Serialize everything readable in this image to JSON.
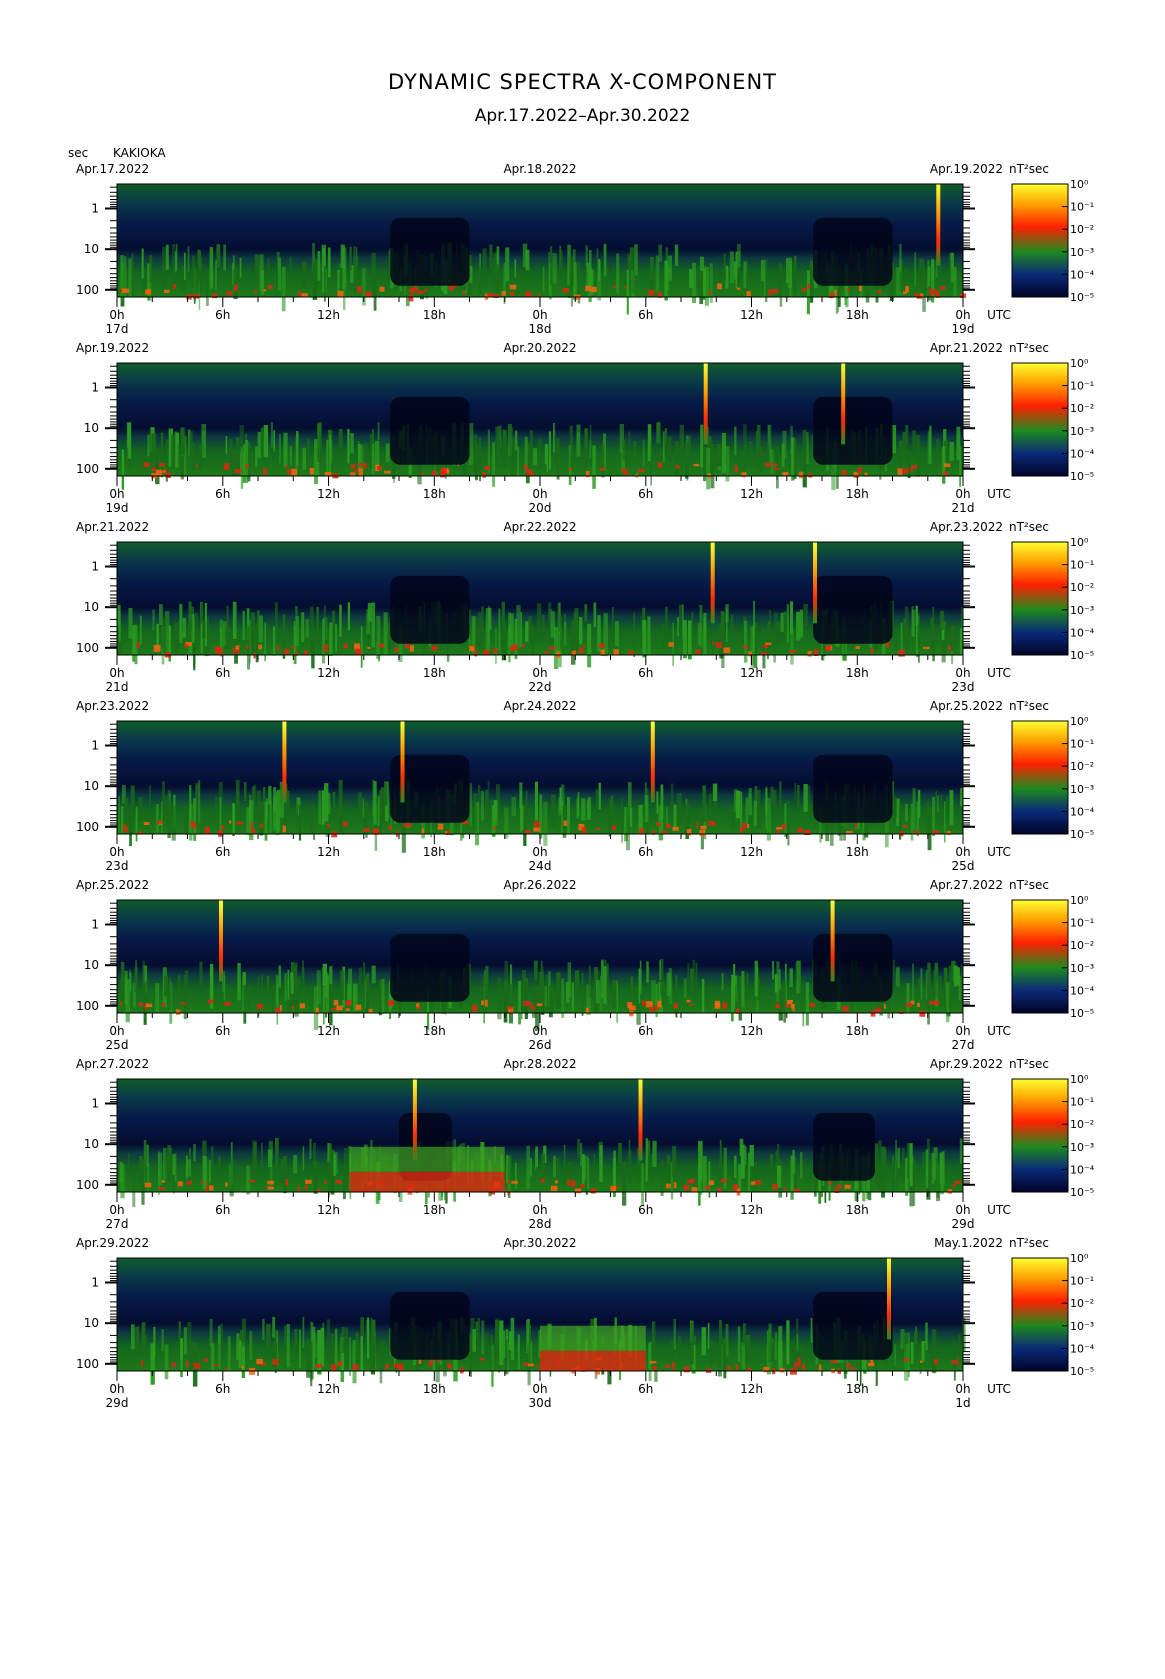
{
  "title": "DYNAMIC SPECTRA X-COMPONENT",
  "subtitle": "Apr.17.2022–Apr.30.2022",
  "y_unit": "sec",
  "station": "KAKIOKA",
  "colorbar_unit": "nT²sec",
  "time_unit": "UTC",
  "chart_data": {
    "type": "heatmap",
    "title": "DYNAMIC SPECTRA X-COMPONENT",
    "subtitle": "Apr.17.2022–Apr.30.2022",
    "ylabel": "sec",
    "yscale": "log",
    "ylim_period_sec": [
      0.25,
      150
    ],
    "yticks": [
      "1",
      "10",
      "100"
    ],
    "xticks": [
      "0h",
      "6h",
      "12h",
      "18h",
      "0h",
      "6h",
      "12h",
      "18h",
      "0h"
    ],
    "colorbar": {
      "unit": "nT²sec",
      "ticks": [
        "10⁰",
        "10⁻¹",
        "10⁻²",
        "10⁻³",
        "10⁻⁴",
        "10⁻⁵"
      ],
      "colors": [
        "#000428",
        "#0a2a78",
        "#1e8a1e",
        "#ff2000",
        "#ffa000",
        "#ffff30"
      ]
    },
    "panels": [
      {
        "dates": [
          "Apr.17.2022",
          "Apr.18.2022",
          "Apr.19.2022"
        ],
        "days": [
          "17d",
          "18d",
          "19d"
        ],
        "bursts_hours": [
          46.6
        ],
        "quiet_hours": [
          [
            15.5,
            20
          ],
          [
            39.5,
            44
          ]
        ],
        "strong_hours": []
      },
      {
        "dates": [
          "Apr.19.2022",
          "Apr.20.2022",
          "Apr.21.2022"
        ],
        "days": [
          "19d",
          "20d",
          "21d"
        ],
        "bursts_hours": [
          33.4,
          41.2
        ],
        "quiet_hours": [
          [
            15.5,
            20
          ],
          [
            39.5,
            44
          ]
        ],
        "strong_hours": []
      },
      {
        "dates": [
          "Apr.21.2022",
          "Apr.22.2022",
          "Apr.23.2022"
        ],
        "days": [
          "21d",
          "22d",
          "23d"
        ],
        "bursts_hours": [
          33.8,
          39.6
        ],
        "quiet_hours": [
          [
            15.5,
            20
          ],
          [
            39.5,
            44
          ]
        ],
        "strong_hours": []
      },
      {
        "dates": [
          "Apr.23.2022",
          "Apr.24.2022",
          "Apr.25.2022"
        ],
        "days": [
          "23d",
          "24d",
          "25d"
        ],
        "bursts_hours": [
          9.5,
          16.2,
          30.4
        ],
        "quiet_hours": [
          [
            15.5,
            20
          ],
          [
            39.5,
            44
          ]
        ],
        "strong_hours": []
      },
      {
        "dates": [
          "Apr.25.2022",
          "Apr.26.2022",
          "Apr.27.2022"
        ],
        "days": [
          "25d",
          "26d",
          "27d"
        ],
        "bursts_hours": [
          5.9,
          40.6
        ],
        "quiet_hours": [
          [
            15.5,
            20
          ],
          [
            39.5,
            44
          ]
        ],
        "strong_hours": []
      },
      {
        "dates": [
          "Apr.27.2022",
          "Apr.28.2022",
          "Apr.29.2022"
        ],
        "days": [
          "27d",
          "28d",
          "29d"
        ],
        "bursts_hours": [
          16.9,
          29.7
        ],
        "quiet_hours": [
          [
            16,
            19
          ],
          [
            39.5,
            43
          ]
        ],
        "strong_hours": [
          [
            13.2,
            22
          ]
        ]
      },
      {
        "dates": [
          "Apr.29.2022",
          "Apr.30.2022",
          "May.1.2022"
        ],
        "days": [
          "29d",
          "30d",
          "1d"
        ],
        "bursts_hours": [
          43.8
        ],
        "quiet_hours": [
          [
            15.5,
            20
          ],
          [
            39.5,
            44
          ]
        ],
        "strong_hours": [
          [
            24,
            30
          ]
        ]
      }
    ]
  }
}
